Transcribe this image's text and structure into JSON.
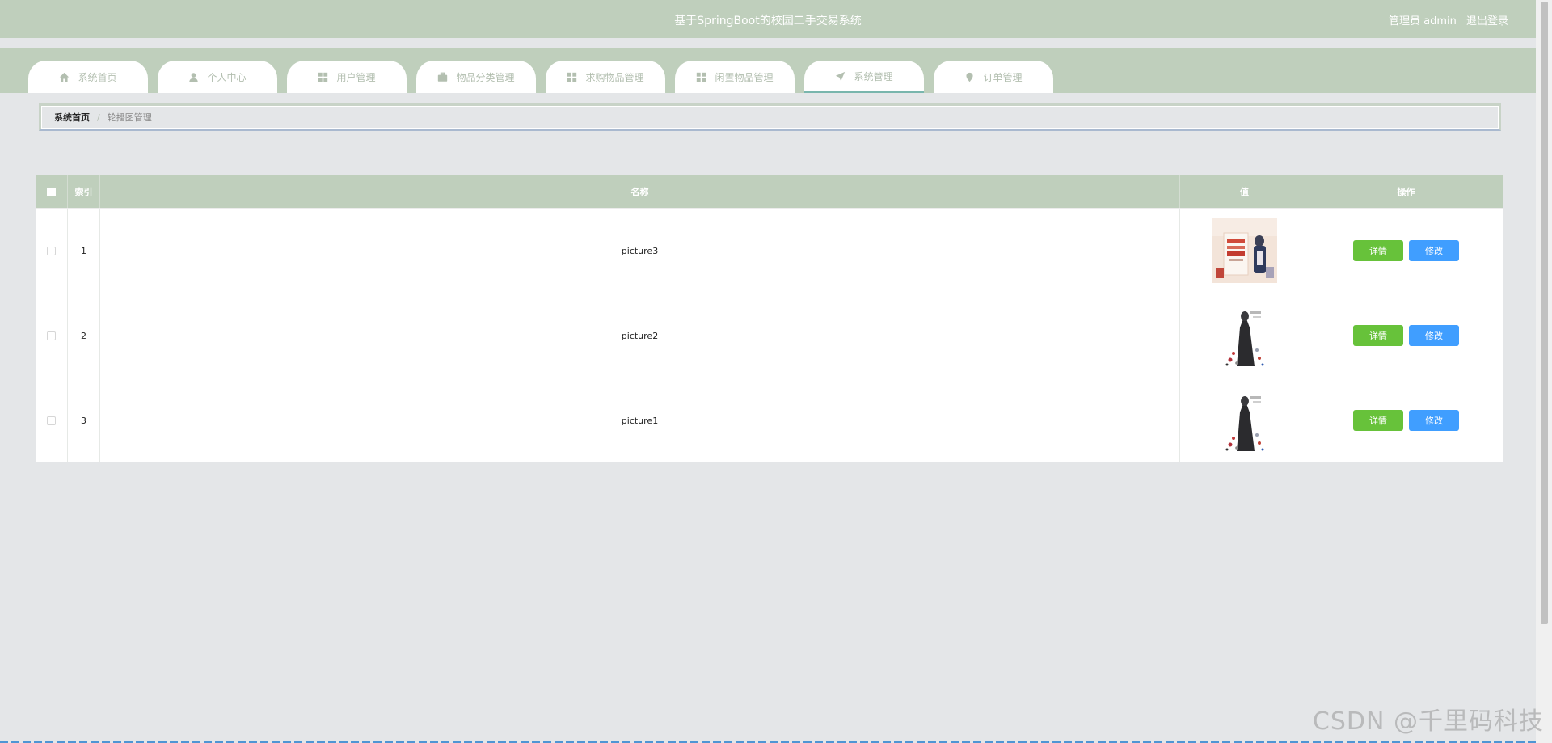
{
  "header": {
    "title": "基于SpringBoot的校园二手交易系统",
    "user_label": "管理员 admin",
    "logout_label": "退出登录"
  },
  "nav": {
    "tabs": [
      {
        "label": "系统首页",
        "icon": "home-icon"
      },
      {
        "label": "个人中心",
        "icon": "user-icon"
      },
      {
        "label": "用户管理",
        "icon": "grid-icon"
      },
      {
        "label": "物品分类管理",
        "icon": "briefcase-icon"
      },
      {
        "label": "求购物品管理",
        "icon": "grid-icon"
      },
      {
        "label": "闲置物品管理",
        "icon": "grid-icon"
      },
      {
        "label": "系统管理",
        "icon": "send-icon",
        "active": true
      },
      {
        "label": "订单管理",
        "icon": "location-pin-icon"
      }
    ]
  },
  "breadcrumb": {
    "home": "系统首页",
    "separator": "/",
    "current": "轮播图管理"
  },
  "table": {
    "columns": [
      "索引",
      "名称",
      "值",
      "操作"
    ],
    "rows": [
      {
        "index": "1",
        "name": "picture3",
        "image": "poster-thumbnail"
      },
      {
        "index": "2",
        "name": "picture2",
        "image": "figure-thumbnail"
      },
      {
        "index": "3",
        "name": "picture1",
        "image": "figure-thumbnail"
      }
    ],
    "detail_label": "详情",
    "edit_label": "修改"
  },
  "watermark": "CSDN @千里码科技",
  "colors": {
    "header_bg": "#bfcfbc",
    "page_bg": "#e4e6e8",
    "detail_button": "#67c23a",
    "edit_button": "#409eff",
    "nav_text": "#b3bfb0"
  }
}
